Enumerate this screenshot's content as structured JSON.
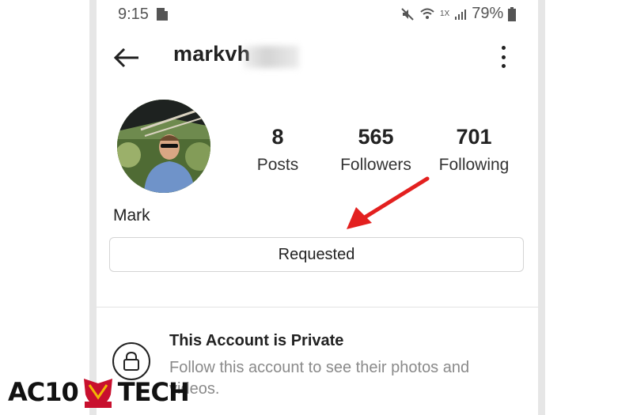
{
  "status_bar": {
    "time": "9:15",
    "network_badge": "1X",
    "battery": "79%"
  },
  "header": {
    "username": "markvh",
    "back_icon": "arrow-left-icon",
    "menu_icon": "more-vert-icon"
  },
  "profile": {
    "stats": [
      {
        "value": "8",
        "label": "Posts"
      },
      {
        "value": "565",
        "label": "Followers"
      },
      {
        "value": "701",
        "label": "Following"
      }
    ],
    "display_name": "Mark",
    "follow_button_label": "Requested"
  },
  "private_notice": {
    "title": "This Account is Private",
    "subtitle": "Follow this account to see their photos and videos.",
    "icon": "lock-icon"
  },
  "watermark": {
    "left_text": "AC10",
    "right_text": "TECH",
    "badge_text": "AC10 Tech"
  },
  "colors": {
    "annotation_arrow": "#e3201f",
    "logo_shield": "#c8102e",
    "logo_gold": "#f2b705"
  }
}
